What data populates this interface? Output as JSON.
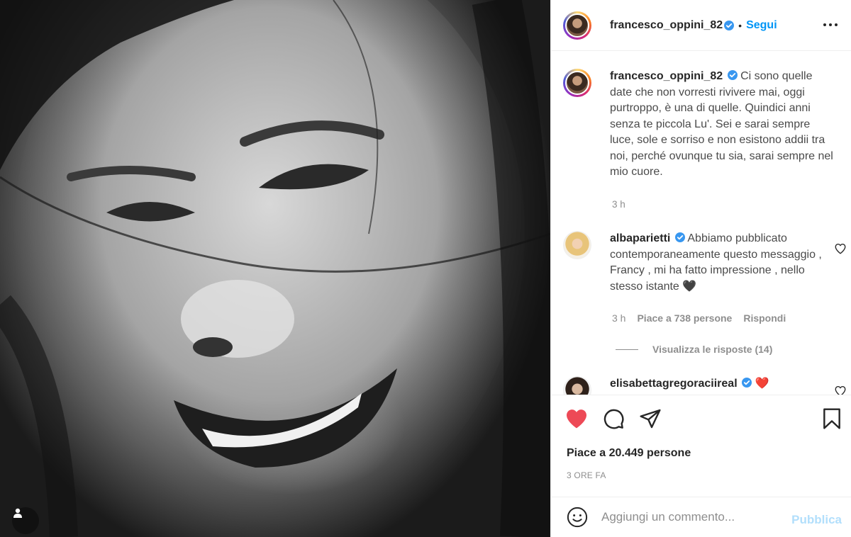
{
  "post": {
    "photo_description_icon": "user-tag-icon"
  },
  "header": {
    "username": "francesco_oppini_82",
    "separator": "•",
    "follow_label": "Segui",
    "more_icon": "more-horizontal-icon"
  },
  "caption": {
    "username": "francesco_oppini_82",
    "text": "Ci sono quelle date che non vorresti rivivere mai, oggi purtroppo, è una di quelle. Quindici anni senza te piccola Lu'. Sei e sarai sempre luce, sole e sorriso e non esistono addii tra noi, perché ovunque tu sia, sarai sempre nel mio cuore.",
    "time": "3 h"
  },
  "comments": [
    {
      "username": "albaparietti",
      "text": "Abbiamo pubblicato contemporaneamente questo messaggio , Francy , mi ha fatto impressione , nello stesso istante 🖤",
      "time": "3 h",
      "likes": "Piace a 738 persone",
      "reply_label": "Rispondi",
      "view_replies": "Visualizza le risposte (14)"
    },
    {
      "username": "elisabettagregoraciireal",
      "text": "❤️"
    }
  ],
  "actions": {
    "likes": "Piace a 20.449 persone",
    "posted_ago": "3 ORE FA",
    "like_color": "#ed4956"
  },
  "add_comment": {
    "placeholder": "Aggiungi un commento...",
    "publish_label": "Pubblica"
  },
  "colors": {
    "accent": "#0095f6",
    "verified": "#3897f0",
    "muted": "#8e8e8e"
  }
}
